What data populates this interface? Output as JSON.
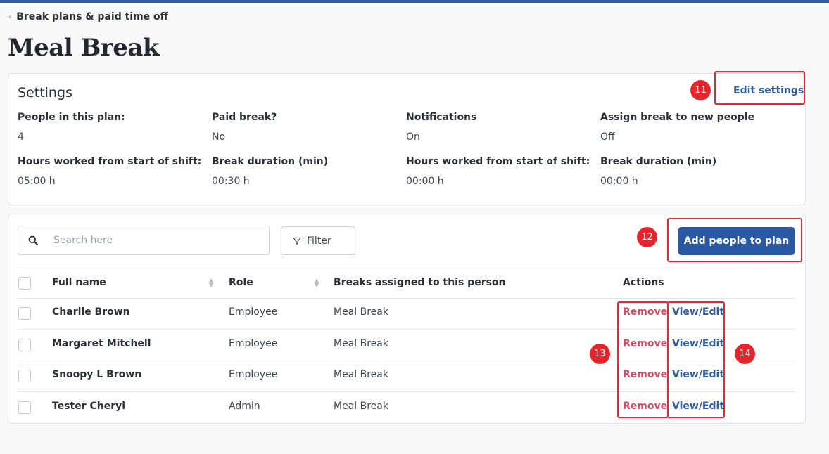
{
  "breadcrumb": {
    "label": "Break plans & paid time off"
  },
  "page": {
    "title": "Meal Break"
  },
  "settings": {
    "title": "Settings",
    "edit_label": "Edit settings",
    "fields": [
      {
        "label": "People in this plan:",
        "value": "4"
      },
      {
        "label": "Paid break?",
        "value": "No"
      },
      {
        "label": "Notifications",
        "value": "On"
      },
      {
        "label": "Assign break to new people",
        "value": "Off"
      },
      {
        "label": "Hours worked from start of shift:",
        "value": "05:00 h"
      },
      {
        "label": "Break duration (min)",
        "value": "00:30 h"
      },
      {
        "label": "Hours worked from start of shift:",
        "value": "00:00 h"
      },
      {
        "label": "Break duration (min)",
        "value": "00:00 h"
      }
    ]
  },
  "toolbar": {
    "search_placeholder": "Search here",
    "filter_label": "Filter",
    "add_label": "Add people to plan"
  },
  "table": {
    "columns": {
      "name": "Full name",
      "role": "Role",
      "breaks": "Breaks assigned to this person",
      "actions": "Actions"
    },
    "rows": [
      {
        "name": "Charlie Brown",
        "role": "Employee",
        "breaks": "Meal Break",
        "remove": "Remove",
        "view": "View/Edit"
      },
      {
        "name": "Margaret Mitchell",
        "role": "Employee",
        "breaks": "Meal Break",
        "remove": "Remove",
        "view": "View/Edit"
      },
      {
        "name": "Snoopy L Brown",
        "role": "Employee",
        "breaks": "Meal Break",
        "remove": "Remove",
        "view": "View/Edit"
      },
      {
        "name": "Tester Cheryl",
        "role": "Admin",
        "breaks": "Meal Break",
        "remove": "Remove",
        "view": "View/Edit"
      }
    ]
  },
  "annotations": [
    "11",
    "12",
    "13",
    "14"
  ],
  "colors": {
    "accent": "#2a58a3",
    "link": "#2f5ca8",
    "danger": "#d64862",
    "highlight": "#e4282e"
  }
}
